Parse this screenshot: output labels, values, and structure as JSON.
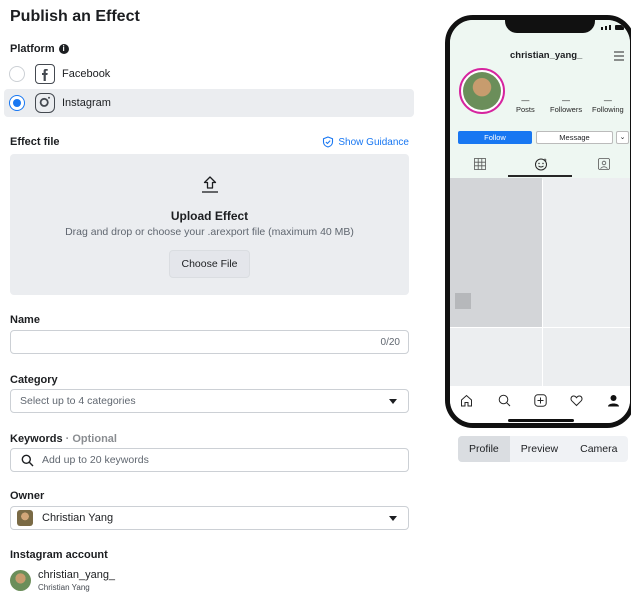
{
  "page": {
    "title": "Publish an Effect"
  },
  "platform": {
    "label": "Platform",
    "options": [
      {
        "label": "Facebook",
        "selected": false,
        "icon": "facebook-icon"
      },
      {
        "label": "Instagram",
        "selected": true,
        "icon": "instagram-icon"
      }
    ]
  },
  "effect_file": {
    "label": "Effect file",
    "guidance": "Show Guidance",
    "upload_title": "Upload Effect",
    "upload_sub": "Drag and drop or choose your .arexport file (maximum 40 MB)",
    "choose_button": "Choose File"
  },
  "name": {
    "label": "Name",
    "value": "",
    "counter": "0/20"
  },
  "category": {
    "label": "Category",
    "placeholder": "Select up to 4 categories"
  },
  "keywords": {
    "label": "Keywords",
    "optional": "· Optional",
    "placeholder": "Add up to 20 keywords"
  },
  "owner": {
    "label": "Owner",
    "value": "Christian Yang"
  },
  "instagram_account": {
    "label": "Instagram account",
    "username": "christian_yang_",
    "fullname": "Christian Yang"
  },
  "preview": {
    "username": "christian_yang_",
    "stats": [
      {
        "value": "—",
        "label": "Posts"
      },
      {
        "value": "—",
        "label": "Followers"
      },
      {
        "value": "—",
        "label": "Following"
      }
    ],
    "follow": "Follow",
    "message": "Message",
    "modes": [
      "Profile",
      "Preview",
      "Camera"
    ],
    "active_mode": "Profile"
  },
  "colors": {
    "accent": "#1877f2",
    "panel": "#ebedf0"
  }
}
